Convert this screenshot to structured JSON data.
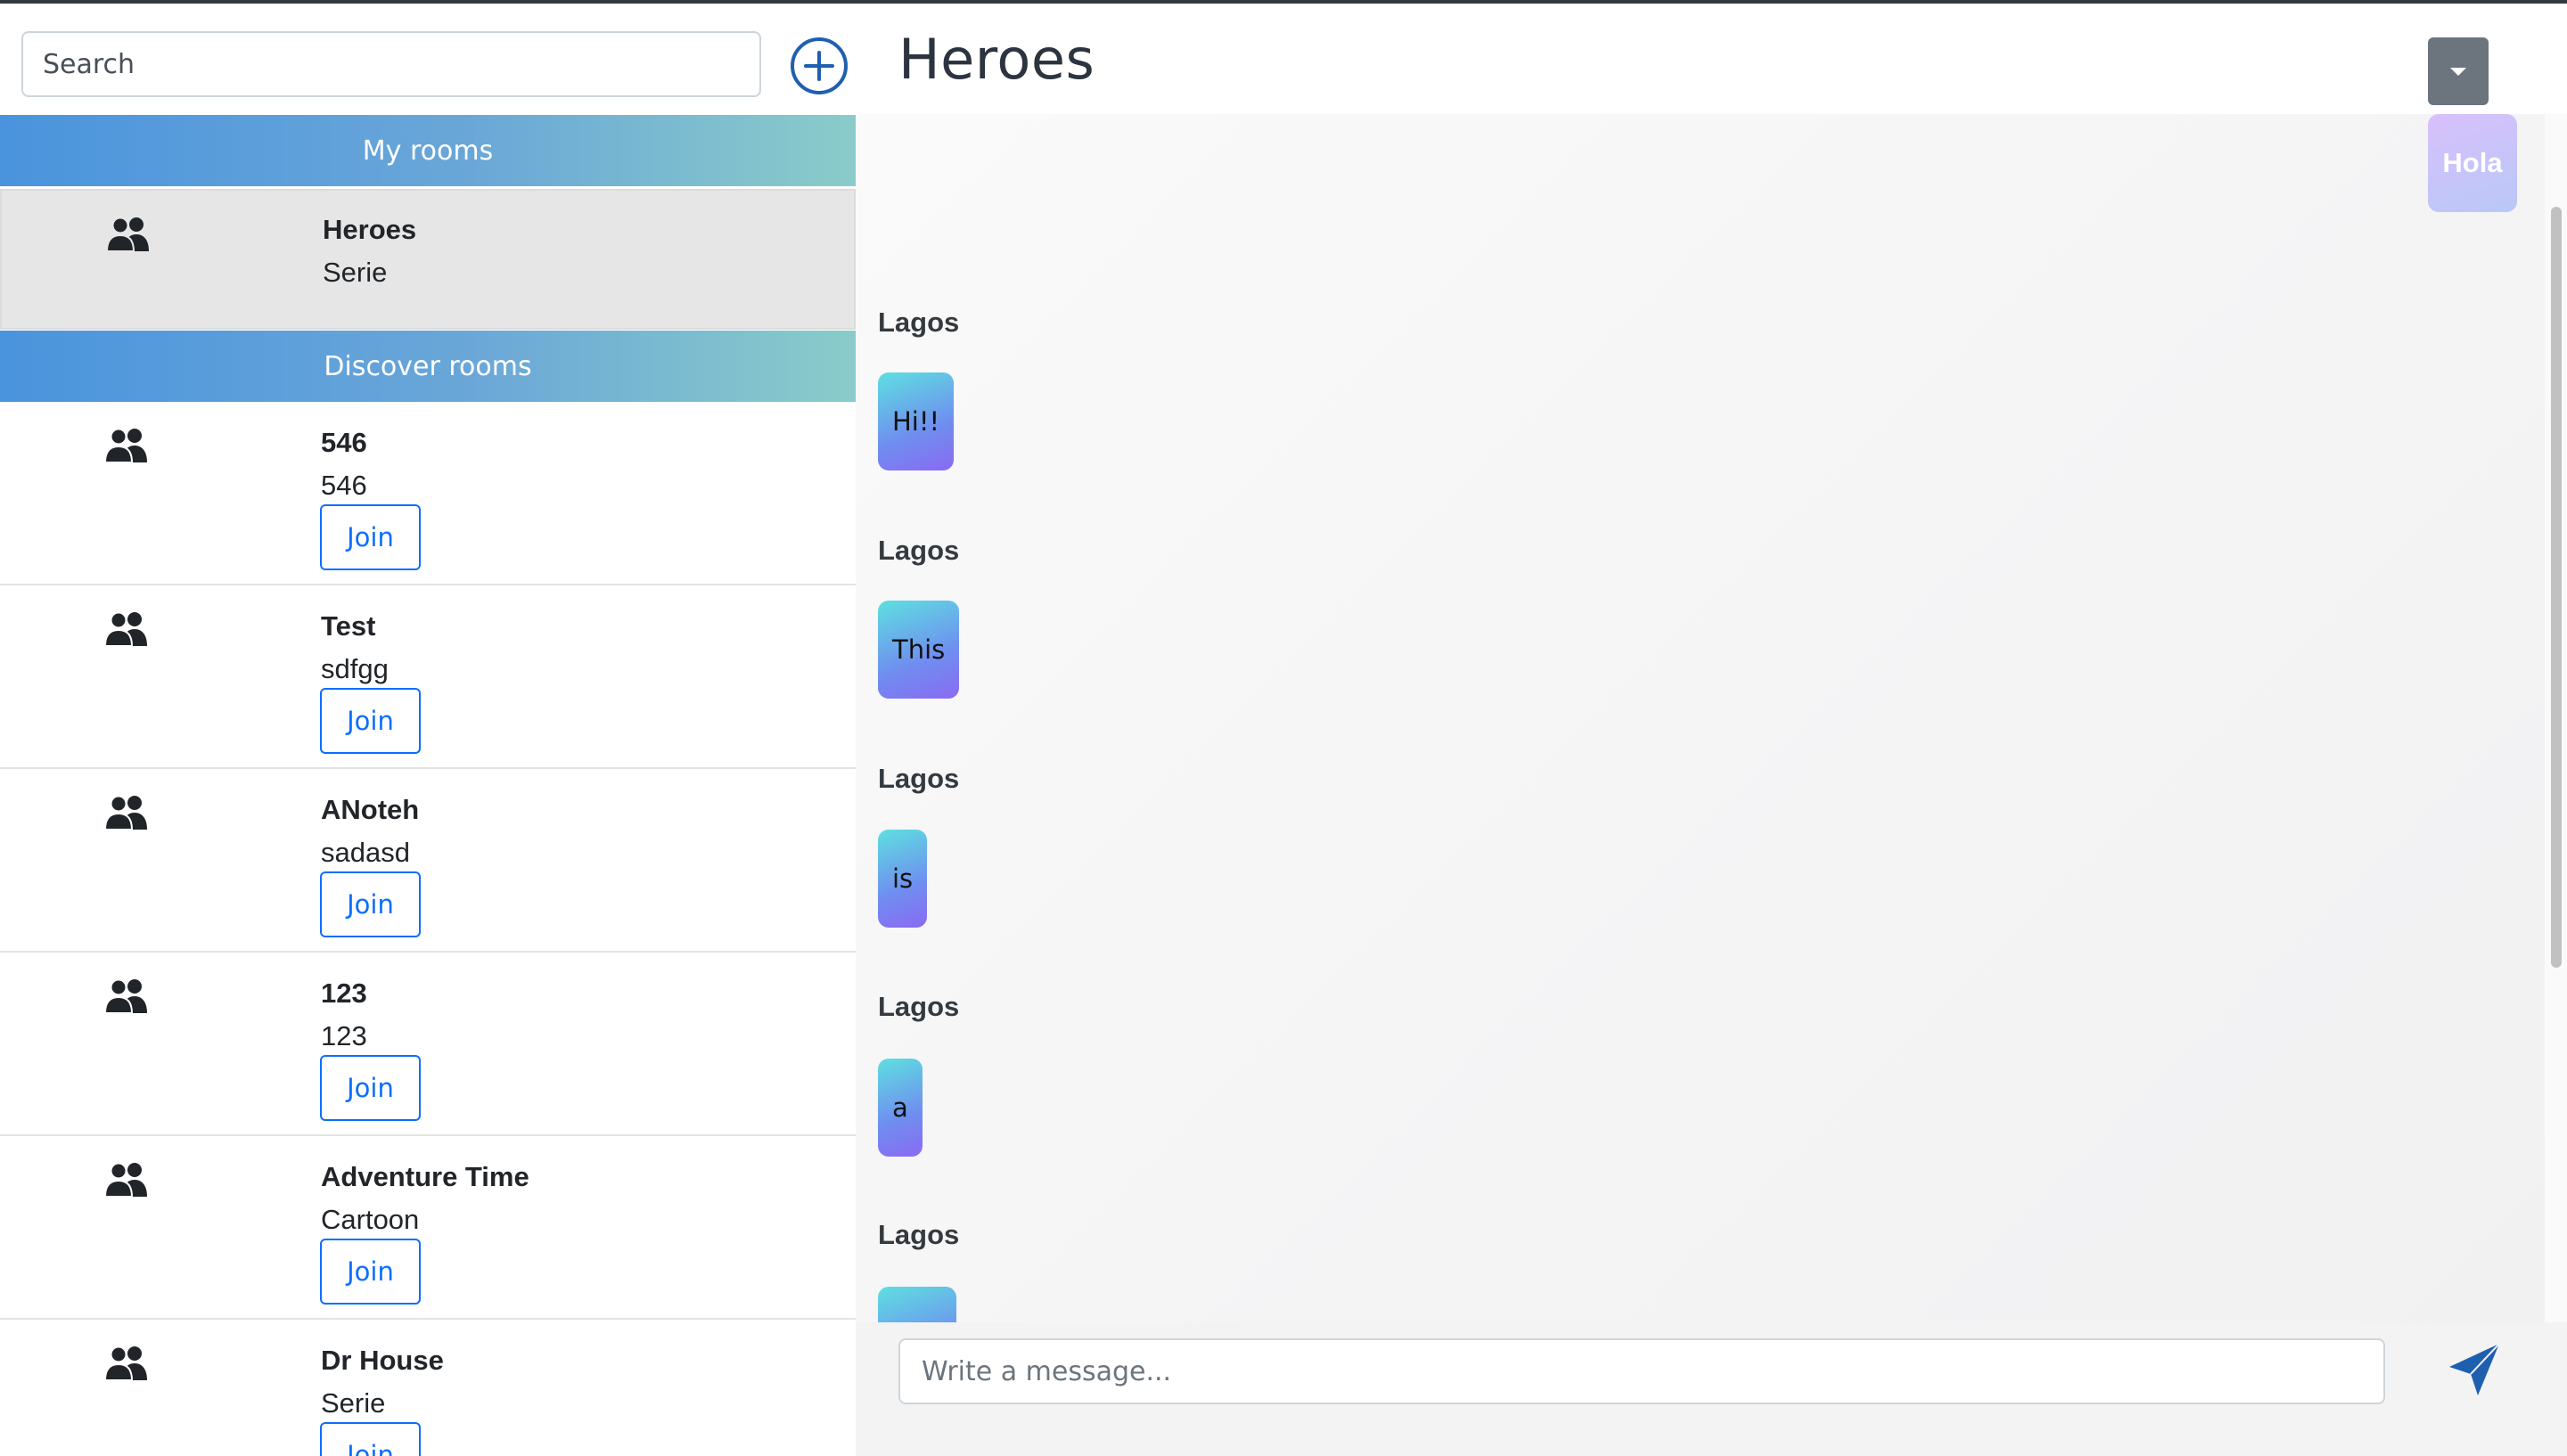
{
  "search": {
    "placeholder": "Search"
  },
  "sidebar": {
    "my_rooms_label": "My rooms",
    "discover_rooms_label": "Discover rooms",
    "my_rooms": [
      {
        "name": "Heroes",
        "description": "Serie",
        "icon": "users-icon"
      }
    ],
    "discover_rooms": [
      {
        "name": "546",
        "description": "546",
        "join_label": "Join",
        "icon": "users-icon"
      },
      {
        "name": "Test",
        "description": "sdfgg",
        "join_label": "Join",
        "icon": "users-icon"
      },
      {
        "name": "ANoteh",
        "description": "sadasd",
        "join_label": "Join",
        "icon": "users-icon"
      },
      {
        "name": "123",
        "description": "123",
        "join_label": "Join",
        "icon": "users-icon"
      },
      {
        "name": "Adventure Time",
        "description": "Cartoon",
        "join_label": "Join",
        "icon": "users-icon"
      },
      {
        "name": "Dr House",
        "description": "Serie",
        "join_label": "Join",
        "icon": "users-icon"
      }
    ]
  },
  "chat": {
    "title": "Heroes",
    "own_messages": [
      {
        "text": "Hola"
      }
    ],
    "messages": [
      {
        "sender": "Lagos",
        "text": "Hi!!"
      },
      {
        "sender": "Lagos",
        "text": "This"
      },
      {
        "sender": "Lagos",
        "text": "is"
      },
      {
        "sender": "Lagos",
        "text": "a"
      },
      {
        "sender": "Lagos",
        "text": ""
      }
    ],
    "composer": {
      "placeholder": "Write a message..."
    }
  },
  "colors": {
    "accent": "#0d6efd",
    "header_gradient_start": "#4a94dd",
    "header_gradient_end": "#8accc9",
    "dropdown_bg": "#6c757d",
    "send_icon": "#1f5fb0"
  },
  "icons": {
    "add": "plus-circle-icon",
    "room": "users-icon",
    "dropdown": "caret-down-icon",
    "send": "paper-plane-icon"
  }
}
